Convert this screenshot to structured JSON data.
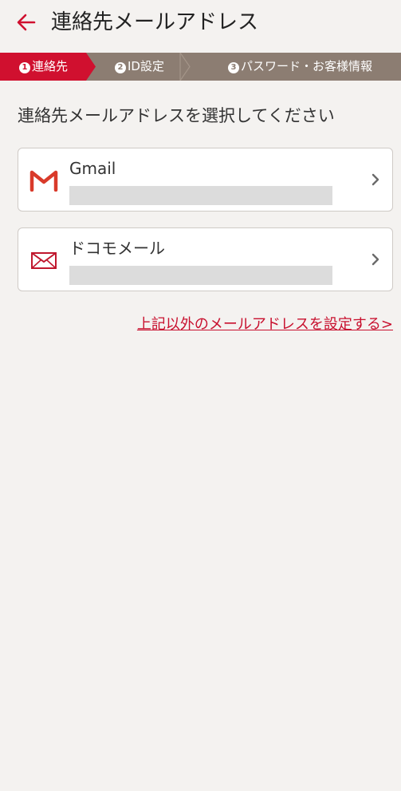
{
  "header": {
    "title": "連絡先メールアドレス",
    "back_icon": "arrow-left-icon",
    "accent_color": "#d0102f"
  },
  "steps": {
    "items": [
      {
        "number": "1",
        "label": "連絡先",
        "active": true
      },
      {
        "number": "2",
        "label": "ID設定",
        "active": false
      },
      {
        "number": "3",
        "label": "パスワード・お客様情報",
        "active": false
      }
    ],
    "active_color": "#d0102f",
    "inactive_color": "#8c7d72"
  },
  "main": {
    "instruction": "連絡先メールアドレスを選択してください",
    "options": [
      {
        "name": "Gmail",
        "address": "",
        "icon": "gmail-icon"
      },
      {
        "name": "ドコモメール",
        "address": "",
        "icon": "mail-envelope-icon"
      }
    ],
    "other_link": "上記以外のメールアドレスを設定する>"
  }
}
